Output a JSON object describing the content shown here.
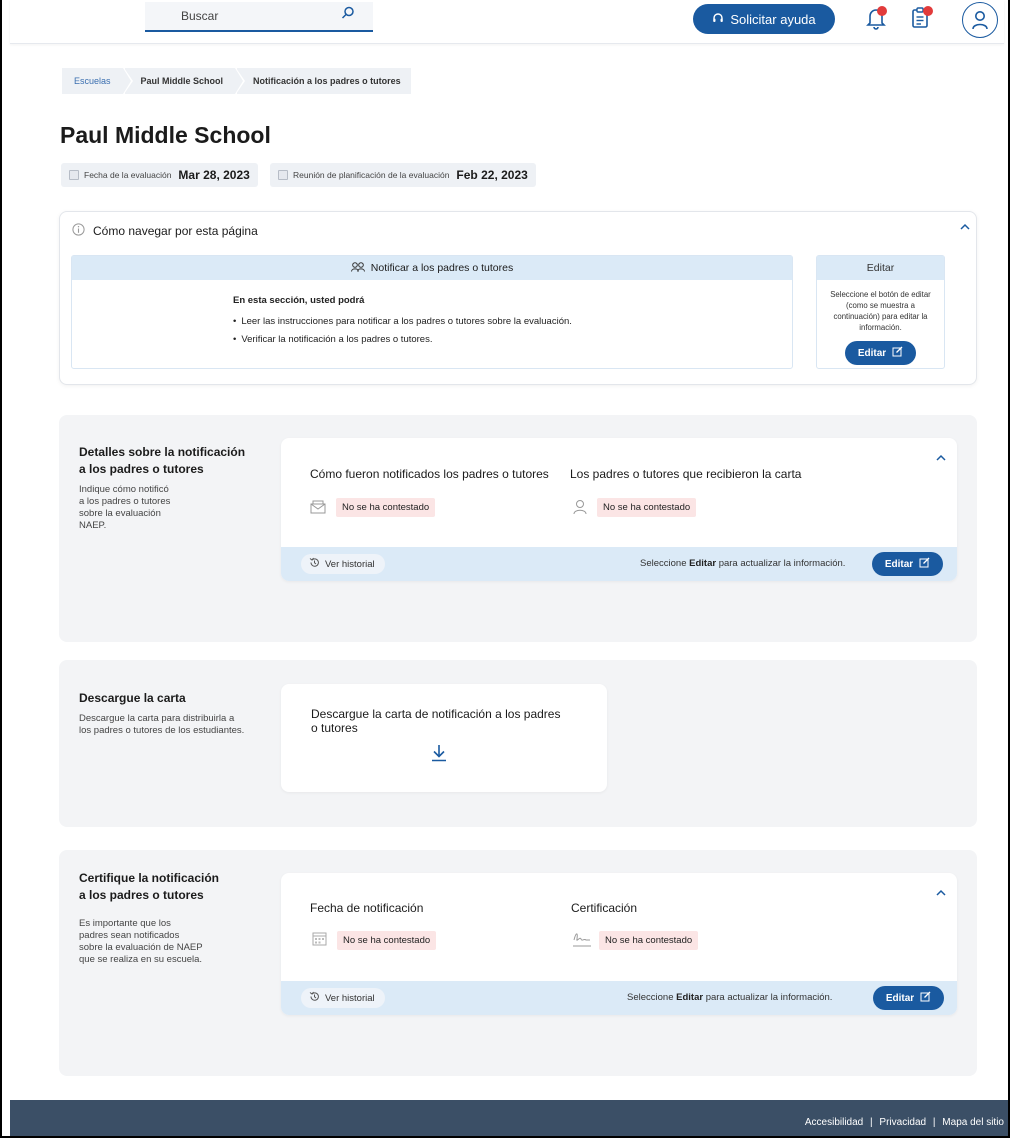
{
  "header": {
    "search_placeholder": "Buscar",
    "help_button": "Solicitar ayuda"
  },
  "breadcrumb": [
    "Escuelas",
    "Paul Middle School",
    "Notificación a los padres o tutores"
  ],
  "page": {
    "title": "Paul Middle School",
    "eval_date_label": "Fecha de la evaluación",
    "eval_date": "Mar 28, 2023",
    "meeting_label": "Reunión de planificación de la evaluación",
    "meeting_date": "Feb 22, 2023"
  },
  "nav_card": {
    "title": "Cómo navegar por esta página",
    "notify_header": "Notificar a los padres o tutores",
    "intro": "En esta sección, usted podrá",
    "bullets": [
      "Leer las instrucciones para notificar a los padres o tutores sobre la evaluación.",
      "Verificar la notificación a los padres o tutores."
    ],
    "edit_header": "Editar",
    "edit_text": "Seleccione el botón de editar (como se muestra a continuación) para editar la información.",
    "edit_button": "Editar"
  },
  "details": {
    "title_line1": "Detalles sobre la notificación",
    "title_line2": "a los padres o tutores",
    "desc_lines": [
      "Indique cómo notificó",
      "a los padres o tutores",
      "sobre la evaluación",
      "NAEP."
    ],
    "col1_head": "Cómo fueron notificados los padres o tutores",
    "col2_head": "Los padres o tutores que recibieron la carta",
    "col1_value": "No se ha contestado",
    "col2_value": "No se ha contestado",
    "history": "Ver historial",
    "foot_pre": "Seleccione ",
    "foot_bold": "Editar",
    "foot_post": " para actualizar la información.",
    "edit_button": "Editar"
  },
  "download": {
    "title": "Descargue la carta",
    "desc_lines": [
      "Descargue la carta para distribuirla a",
      "los padres o tutores de los estudiantes."
    ],
    "card_line1": "Descargue la carta de notificación a los padres",
    "card_line2": "o tutores"
  },
  "certify": {
    "title_line1": "Certifique la notificación",
    "title_line2": "a los padres o tutores",
    "desc_lines": [
      "Es importante que los",
      "padres sean notificados",
      "sobre la evaluación de NAEP",
      "que se realiza en su escuela."
    ],
    "col1_head": "Fecha de notificación",
    "col2_head": "Certificación",
    "col1_value": "No se ha contestado",
    "col2_value": "No se ha contestado",
    "history": "Ver historial",
    "foot_pre": "Seleccione ",
    "foot_bold": "Editar",
    "foot_post": " para actualizar la información.",
    "edit_button": "Editar"
  },
  "footer": {
    "links": [
      "Accesibilidad",
      "Privacidad",
      "Mapa del sitio"
    ],
    "separator": "|"
  },
  "colors": {
    "primary": "#1a5aa0",
    "light_blue": "#dbeaf7",
    "section_bg": "#f3f4f6",
    "badge_bg": "#fbe5e5",
    "notification_dot": "#e23b3b",
    "footer_bg": "#3b4f66"
  }
}
